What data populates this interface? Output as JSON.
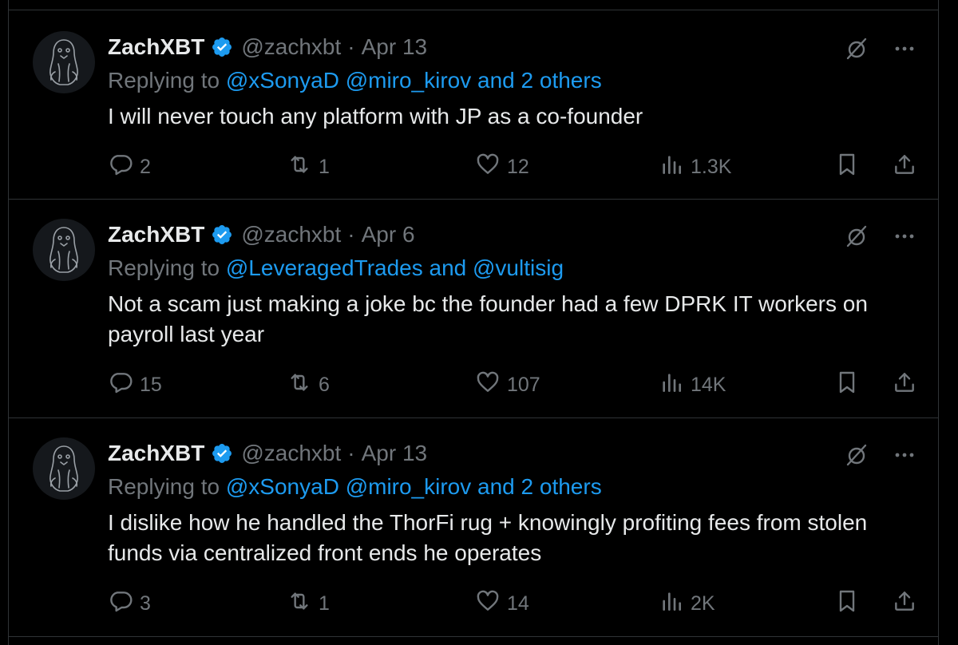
{
  "tweets": [
    {
      "name": "ZachXBT",
      "handle": "@zachxbt",
      "dot": "·",
      "date": "Apr 13",
      "replying_prefix": "Replying to",
      "replying_links": "@xSonyaD @miro_kirov and 2 others",
      "text": "I will never touch any platform with JP as a co-founder",
      "replies": "2",
      "retweets": "1",
      "likes": "12",
      "views": "1.3K"
    },
    {
      "name": "ZachXBT",
      "handle": "@zachxbt",
      "dot": "·",
      "date": "Apr 6",
      "replying_prefix": "Replying to",
      "replying_links": "@LeveragedTrades and @vultisig",
      "text": "Not a scam just making a joke bc the founder had a few DPRK IT workers on payroll last year",
      "replies": "15",
      "retweets": "6",
      "likes": "107",
      "views": "14K"
    },
    {
      "name": "ZachXBT",
      "handle": "@zachxbt",
      "dot": "·",
      "date": "Apr 13",
      "replying_prefix": "Replying to",
      "replying_links": "@xSonyaD @miro_kirov and 2 others",
      "text": "I dislike how he handled the ThorFi rug + knowingly profiting fees from stolen funds via centralized front ends he operates",
      "replies": "3",
      "retweets": "1",
      "likes": "14",
      "views": "2K"
    }
  ],
  "icons": {
    "reply": "reply-icon",
    "retweet": "retweet-icon",
    "like": "heart-icon",
    "views": "views-icon",
    "bookmark": "bookmark-icon",
    "share": "share-icon",
    "grok": "grok-icon",
    "more": "more-icon",
    "verified": "verified-badge-icon"
  },
  "colors": {
    "background": "#000000",
    "text": "#e7e9ea",
    "muted": "#71767b",
    "link": "#1d9bf0",
    "border": "#2f3336"
  }
}
